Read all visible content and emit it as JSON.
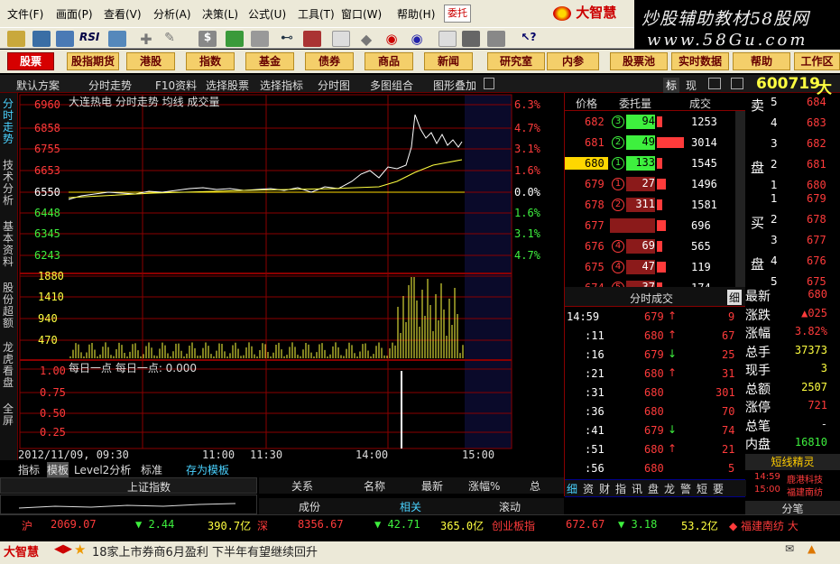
{
  "menu": [
    "文件(F)",
    "画面(P)",
    "查看(V)",
    "分析(A)",
    "决策(L)",
    "公式(U)",
    "工具(T)",
    "窗口(W)",
    "帮助(H)"
  ],
  "consign_label": "委托",
  "brand": "大智慧",
  "watermark": {
    "line1": "炒股辅助教材58股网",
    "line2": "www.58Gu.com"
  },
  "nav": [
    "股票",
    "股指期货",
    "港股",
    "指数",
    "基金",
    "债券",
    "商品",
    "新闻",
    "研究室",
    "内参",
    "股票池",
    "实时数据",
    "帮助",
    "工作区"
  ],
  "sub": [
    "默认方案",
    "分时走势",
    "F10资料",
    "选择股票",
    "选择指标",
    "分时图",
    "多图组合",
    "图形叠加"
  ],
  "vtabs": [
    "分时走势",
    "技术分析",
    "基本资料",
    "股份超额",
    "龙虎看盘",
    "全屏"
  ],
  "stock_code": "600719",
  "stock_name_short": "大",
  "quote_tabs": [
    "标",
    "现"
  ],
  "chart": {
    "title": "大连热电  分时走势  均线  成交量",
    "price_ticks": [
      "6960",
      "6858",
      "6755",
      "6653",
      "6550",
      "6448",
      "6345",
      "6243"
    ],
    "pct_ticks": [
      "6.3%",
      "4.7%",
      "3.1%",
      "1.6%",
      "0.0%",
      "1.6%",
      "3.1%",
      "4.7%"
    ],
    "vol_ticks": [
      "1880",
      "1410",
      "940",
      "470"
    ],
    "ind_title": "每日一点  每日一点: 0.000",
    "ind_ticks": [
      "1.00",
      "0.75",
      "0.50",
      "0.25"
    ],
    "time_labels": [
      "2012/11/09, 09:30",
      "11:00",
      "11:30",
      "14:00",
      "15:00"
    ],
    "time_suffix": "分时"
  },
  "chart_data": {
    "type": "line",
    "prev_close": 6.55,
    "title": "大连热电  分时走势  均线  成交量"
  },
  "book_header": [
    "价格",
    "委托量",
    "成交"
  ],
  "book": [
    {
      "price": "682",
      "lvl": "3",
      "qty": "94",
      "deal": "1253"
    },
    {
      "price": "681",
      "lvl": "2",
      "qty": "49",
      "deal": "3014"
    },
    {
      "price": "680",
      "lvl": "1",
      "qty": "133",
      "deal": "1545"
    },
    {
      "price": "679",
      "lvl": "1",
      "qty": "27",
      "deal": "1496"
    },
    {
      "price": "678",
      "lvl": "2",
      "qty": "311",
      "deal": "1581"
    },
    {
      "price": "677",
      "lvl": "",
      "qty": "",
      "deal": "696"
    },
    {
      "price": "676",
      "lvl": "4",
      "qty": "69",
      "deal": "565"
    },
    {
      "price": "675",
      "lvl": "4",
      "qty": "47",
      "deal": "119"
    },
    {
      "price": "674",
      "lvl": "5",
      "qty": "37",
      "deal": "174"
    }
  ],
  "tick_header": "分时成交",
  "tick_btn": "细",
  "ticks": [
    {
      "t": "14:59",
      "p": "679",
      "d": "up",
      "v": "9"
    },
    {
      "t": ":11",
      "p": "680",
      "d": "up",
      "v": "67"
    },
    {
      "t": ":16",
      "p": "679",
      "d": "down",
      "v": "25"
    },
    {
      "t": ":21",
      "p": "680",
      "d": "up",
      "v": "31"
    },
    {
      "t": ":31",
      "p": "680",
      "d": "",
      "v": "301"
    },
    {
      "t": ":36",
      "p": "680",
      "d": "",
      "v": "70"
    },
    {
      "t": ":41",
      "p": "679",
      "d": "down",
      "v": "74"
    },
    {
      "t": ":51",
      "p": "680",
      "d": "up",
      "v": "21"
    },
    {
      "t": ":56",
      "p": "680",
      "d": "",
      "v": "5"
    },
    {
      "t": "15:00",
      "p": "680",
      "d": "",
      "v": "3"
    }
  ],
  "tick_tabs": [
    "细",
    "资",
    "财",
    "指",
    "讯",
    "盘",
    "龙",
    "警",
    "短",
    "要"
  ],
  "asks": [
    {
      "l": "卖",
      "n": "5",
      "p": "684"
    },
    {
      "l": "",
      "n": "4",
      "p": "683"
    },
    {
      "l": "",
      "n": "3",
      "p": "682"
    },
    {
      "l": "盘",
      "n": "2",
      "p": "681"
    },
    {
      "l": "",
      "n": "1",
      "p": "680"
    }
  ],
  "bids": [
    {
      "l": "",
      "n": "1",
      "p": "679"
    },
    {
      "l": "买",
      "n": "2",
      "p": "678"
    },
    {
      "l": "",
      "n": "3",
      "p": "677"
    },
    {
      "l": "盘",
      "n": "4",
      "p": "676"
    },
    {
      "l": "",
      "n": "5",
      "p": "675"
    }
  ],
  "stats": [
    {
      "k": "最新",
      "v": "680"
    },
    {
      "k": "涨跌",
      "v": "▲025"
    },
    {
      "k": "涨幅",
      "v": "3.82%"
    },
    {
      "k": "总手",
      "v": "37373"
    },
    {
      "k": "现手",
      "v": "3"
    },
    {
      "k": "总额",
      "v": "2507"
    },
    {
      "k": "涨停",
      "v": "721"
    },
    {
      "k": "总笔",
      "v": "-"
    },
    {
      "k": "内盘",
      "v": "16810"
    }
  ],
  "news_title": "短线精灵",
  "news": [
    {
      "t": "14:59",
      "s": "鹿港科技"
    },
    {
      "t": "15:00",
      "s": "福建南纺"
    }
  ],
  "fenbi": "分笔",
  "bottom_tabs": [
    "指标",
    "模板",
    "Level2分析",
    "标准",
    "存为模板"
  ],
  "bottom_index": "上证指数",
  "bottom_cols": [
    "关系",
    "名称",
    "最新",
    "涨幅%",
    "总"
  ],
  "bottom_cols2": [
    "成份",
    "相关",
    "滚动"
  ],
  "status": {
    "sh_label": "沪",
    "sh_idx": "2069.07",
    "sh_chg": "▼ 2.44",
    "sh_amt": "390.7亿",
    "sz_label": "深",
    "sz_idx": "8356.67",
    "sz_chg": "▼ 42.71",
    "sz_amt": "365.0亿",
    "cy_label": "创业板指",
    "cy_idx": "672.67",
    "cy_chg": "▼ 3.18",
    "cy_amt": "53.2亿",
    "ticker": "◆ 福建南纺 大"
  },
  "ticker_brand": "大智慧",
  "headline": "18家上市券商6月盈利  下半年有望继续回升",
  "colors": {
    "up": "#ff3b3b",
    "down": "#3ef03e",
    "grid": "#8b0000",
    "bg": "#000000"
  }
}
